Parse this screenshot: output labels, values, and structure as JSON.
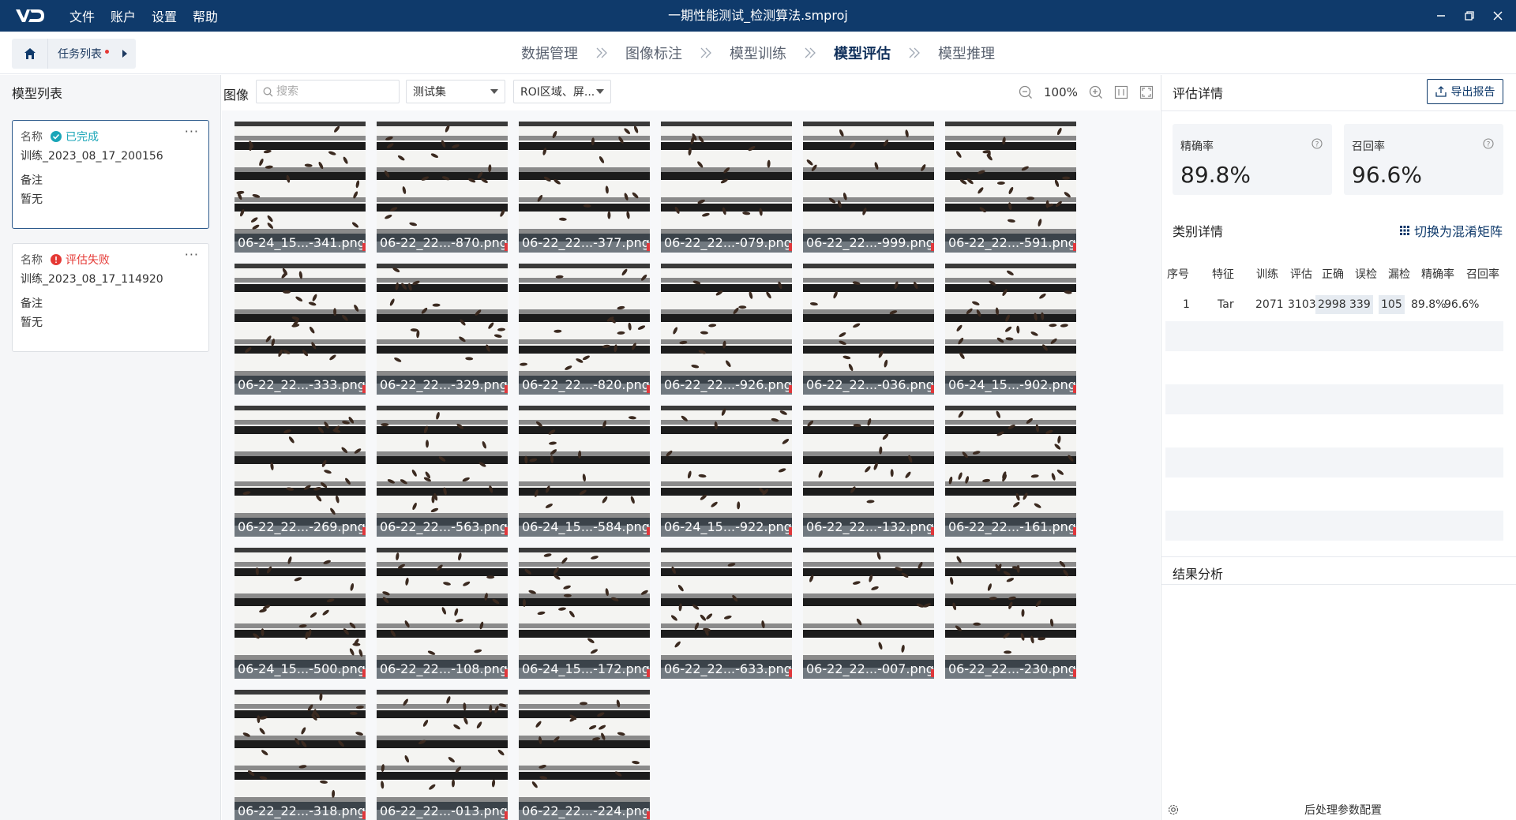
{
  "menu": [
    "文件",
    "账户",
    "设置",
    "帮助"
  ],
  "window_title": "一期性能测试_检测算法.smproj",
  "task_list_label": "任务列表",
  "steps": [
    "数据管理",
    "图像标注",
    "模型训练",
    "模型评估",
    "模型推理"
  ],
  "active_step": "模型评估",
  "left_panel": {
    "title": "模型列表",
    "models": [
      {
        "name_key": "名称",
        "status": "已完成",
        "status_color": "#1aa6b8",
        "name": "训练_2023_08_17_200156",
        "note_key": "备注",
        "note": "暂无"
      },
      {
        "name_key": "名称",
        "status": "评估失败",
        "status_color": "#e53935",
        "name": "训练_2023_08_17_114920",
        "note_key": "备注",
        "note": "暂无"
      }
    ]
  },
  "center": {
    "label": "图像",
    "search_placeholder": "搜索",
    "dataset_select": "测试集",
    "roi_select": "ROI区域、屏...",
    "zoom": "100%",
    "images": [
      "06-24_15...-341.png",
      "06-22_22...-870.png",
      "06-22_22...-377.png",
      "06-22_22...-079.png",
      "06-22_22...-999.png",
      "06-22_22...-591.png",
      "06-22_22...-333.png",
      "06-22_22...-329.png",
      "06-22_22...-820.png",
      "06-22_22...-926.png",
      "06-22_22...-036.png",
      "06-24_15...-902.png",
      "06-22_22...-269.png",
      "06-22_22...-563.png",
      "06-24_15...-584.png",
      "06-24_15...-922.png",
      "06-22_22...-132.png",
      "06-22_22...-161.png",
      "06-24_15...-500.png",
      "06-22_22...-108.png",
      "06-24_15...-172.png",
      "06-22_22...-633.png",
      "06-22_22...-007.png",
      "06-22_22...-230.png",
      "06-22_22...-318.png",
      "06-22_22...-013.png",
      "06-22_22...-224.png"
    ]
  },
  "right_panel": {
    "title": "评估详情",
    "export_label": "导出报告",
    "precision_label": "精确率",
    "precision_value": "89.8%",
    "recall_label": "召回率",
    "recall_value": "96.6%",
    "class_title": "类别详情",
    "switch_label": "切换为混淆矩阵",
    "table_headers": [
      "序号",
      "特征",
      "训练",
      "评估",
      "正确",
      "误检",
      "漏检",
      "精确率",
      "召回率"
    ],
    "table_rows": [
      [
        "1",
        "Tar",
        "2071",
        "3103",
        "2998",
        "339",
        "105",
        "89.8%",
        "96.6%"
      ]
    ],
    "analysis_title": "结果分析",
    "postprocess_label": "后处理参数配置"
  }
}
